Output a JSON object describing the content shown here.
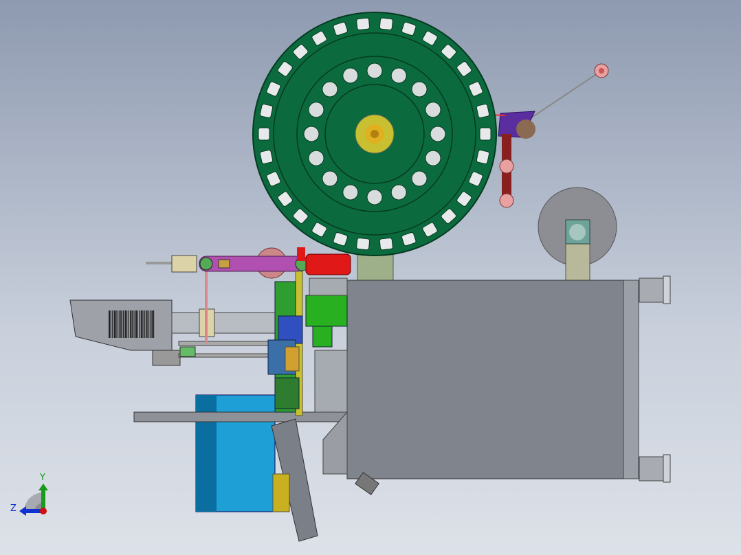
{
  "viewport": {
    "triad": {
      "y_label": "Y",
      "z_label": "Z"
    },
    "colors": {
      "wheel": "#0b6b3e",
      "frame": "#7f838c",
      "drum": "#1e9fd6",
      "axis_y": "#1a9a1a",
      "axis_z": "#1030d0",
      "axis_x": "#d01010"
    }
  }
}
